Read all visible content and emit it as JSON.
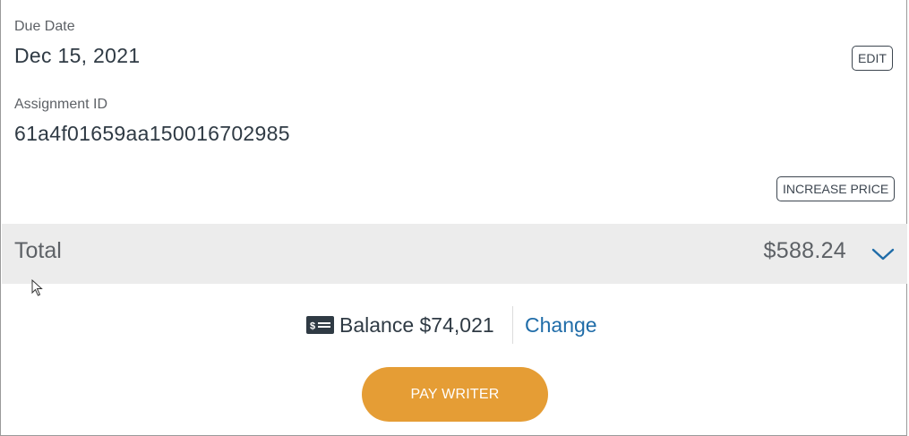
{
  "due_date": {
    "label": "Due Date",
    "value": "Dec 15, 2021",
    "edit_label": "EDIT"
  },
  "assignment": {
    "label": "Assignment ID",
    "value": "61a4f01659aa150016702985"
  },
  "increase_price_label": "INCREASE PRICE",
  "total": {
    "label": "Total",
    "amount": "$588.24",
    "icon": "chevron-down-icon"
  },
  "balance": {
    "icon": "money-icon",
    "text": "Balance $74,021",
    "change_label": "Change"
  },
  "pay_button_label": "PAY WRITER",
  "colors": {
    "accent": "#e59d35",
    "link": "#1f6ca8",
    "total_bg": "#ececec",
    "chevron": "#1f6ca8"
  }
}
